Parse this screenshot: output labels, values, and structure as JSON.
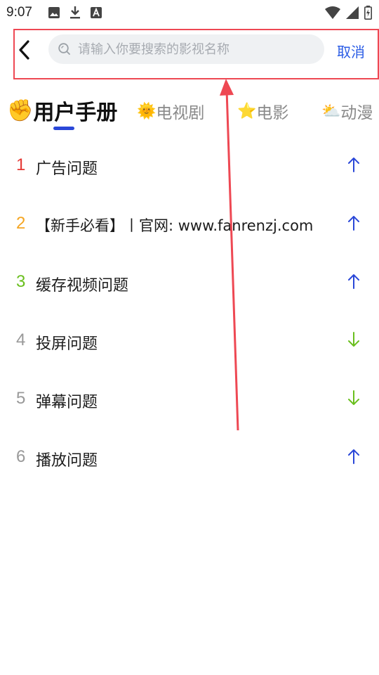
{
  "status_bar": {
    "time": "9:07",
    "icons_left": [
      "image-icon",
      "download-icon",
      "a-badge-icon"
    ],
    "icons_right": [
      "wifi-icon",
      "signal-icon",
      "battery-charging-icon"
    ]
  },
  "search": {
    "back_icon": "chevron-left-icon",
    "placeholder": "请输入你要搜索的影视名称",
    "value": "",
    "cancel_label": "取消"
  },
  "tabs": [
    {
      "emoji": "✊",
      "label": "用户手册",
      "active": true
    },
    {
      "emoji": "🌞",
      "label": "电视剧",
      "active": false
    },
    {
      "emoji": "⭐",
      "label": "电影",
      "active": false
    },
    {
      "emoji": "⛅",
      "label": "动漫",
      "active": false
    }
  ],
  "list": [
    {
      "rank": "1",
      "title": "广告问题",
      "trend": "up"
    },
    {
      "rank": "2",
      "title": "【新手必看】丨官网: www.fanrenzj.com",
      "trend": "up"
    },
    {
      "rank": "3",
      "title": "缓存视频问题",
      "trend": "up"
    },
    {
      "rank": "4",
      "title": "投屏问题",
      "trend": "down"
    },
    {
      "rank": "5",
      "title": "弹幕问题",
      "trend": "down"
    },
    {
      "rank": "6",
      "title": "播放问题",
      "trend": "up"
    }
  ],
  "colors": {
    "accent": "#2a5ce5",
    "rank_1": "#e53935",
    "rank_2": "#f5a623",
    "rank_3": "#6abf1e",
    "rank_other": "#999999",
    "trend_up": "#2a47d8",
    "trend_down": "#6abf1e",
    "annotation": "#ee4853"
  }
}
